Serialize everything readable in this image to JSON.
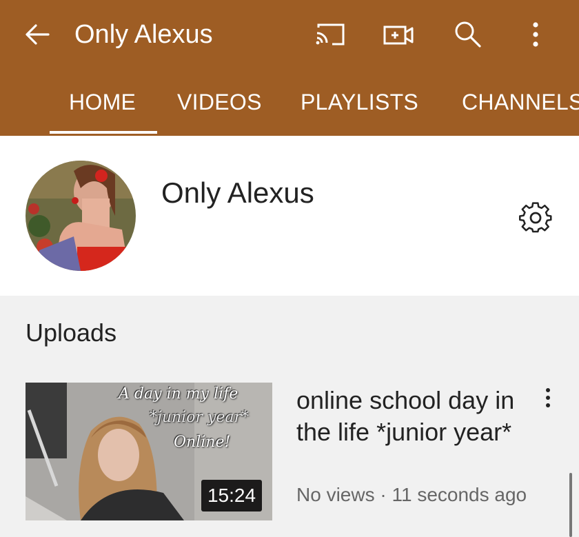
{
  "header": {
    "title": "Only Alexus",
    "icons": [
      "back-arrow-icon",
      "cast-icon",
      "video-camera-icon",
      "search-icon",
      "more-vertical-icon"
    ]
  },
  "tabs": [
    {
      "label": "HOME",
      "active": true
    },
    {
      "label": "VIDEOS",
      "active": false
    },
    {
      "label": "PLAYLISTS",
      "active": false
    },
    {
      "label": "CHANNELS",
      "active": false
    }
  ],
  "channel": {
    "name": "Only Alexus",
    "settings_icon": "gear-icon"
  },
  "sections": {
    "uploads_label": "Uploads"
  },
  "video": {
    "title": "online school day in the life *junior year*",
    "meta": "No views · 11 seconds ago",
    "duration": "15:24",
    "thumbnail_text": {
      "line1": "A day in my life",
      "line2": "*junior year*",
      "line3": "Online!"
    }
  },
  "colors": {
    "accent": "#9e5d24",
    "background": "#f1f1f1"
  }
}
